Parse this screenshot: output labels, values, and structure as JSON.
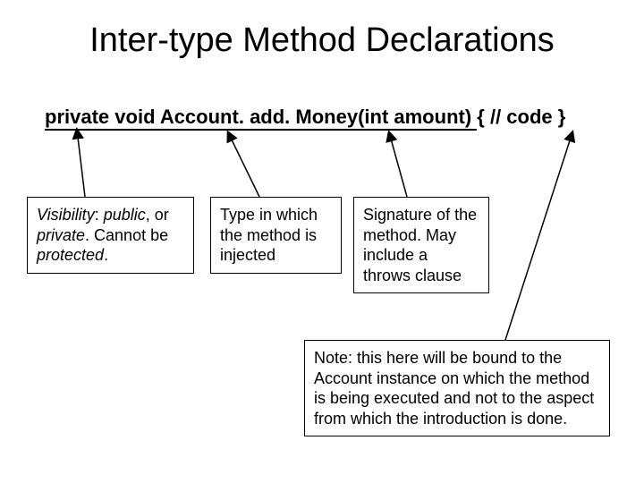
{
  "title": "Inter-type Method Declarations",
  "code": {
    "visibility": "private",
    "ret": "void",
    "type": "Account.",
    "typeSpace": " ",
    "method": "add. Money(int amount)",
    "tail": " { // code }"
  },
  "boxes": {
    "vis": {
      "lead": "Visibility",
      "sep": ": ",
      "opt1": "public",
      "mid1": ", or ",
      "opt2": "private",
      "mid2": ". Cannot be ",
      "opt3": "protected",
      "end": "."
    },
    "typ": "Type in which the method is injected",
    "sig": "Signature of the method. May include a throws clause"
  },
  "note": {
    "pre": "Note: ",
    "this": "this",
    "post": " here will be bound to the Account instance on which the method is being executed and not to the aspect from which the introduction is done."
  }
}
